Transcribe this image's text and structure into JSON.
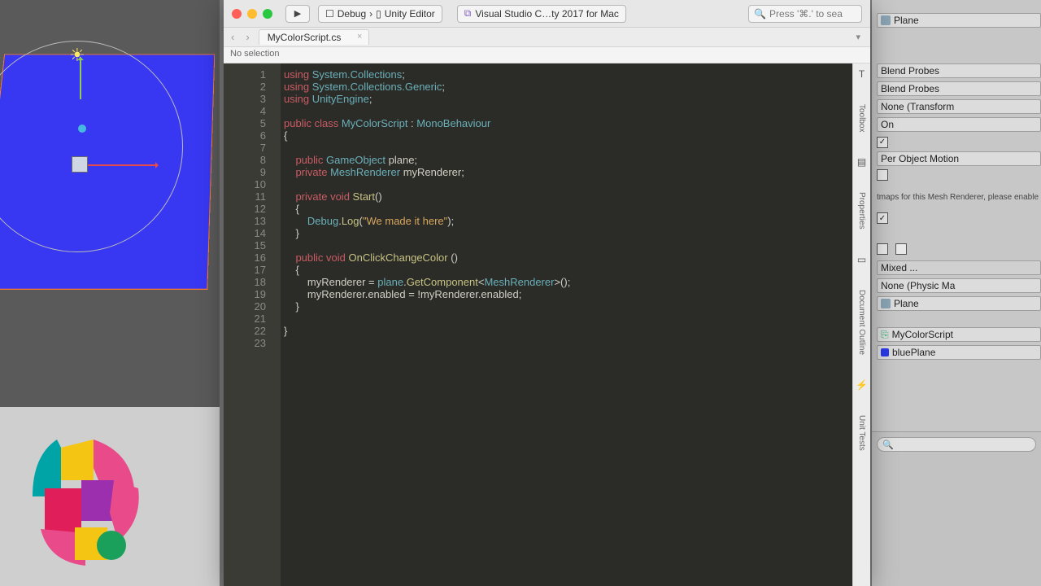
{
  "unity": {
    "inspector": {
      "planeField": "Plane",
      "blendProbes1": "Blend Probes",
      "blendProbes2": "Blend Probes",
      "anchor": "None (Transform",
      "castShadows": "On",
      "motionVectors": "Per Object Motion",
      "lightmapNote": "tmaps for this Mesh Renderer, please enable",
      "tag": "Mixed ...",
      "physicMat": "None (Physic Ma",
      "meshRef": "Plane",
      "scriptRef": "MyColorScript",
      "matRef": "bluePlane"
    }
  },
  "vs": {
    "toolbar": {
      "config": "Debug",
      "target": "Unity Editor",
      "appName": "Visual Studio C…ty 2017 for Mac",
      "searchPlaceholder": "Press '⌘.' to sea"
    },
    "tab": "MyColorScript.cs",
    "breadcrumb": "No selection",
    "sidepanels": [
      "Toolbox",
      "Properties",
      "Document Outline",
      "Unit Tests"
    ],
    "code": {
      "lines": [
        "1",
        "2",
        "3",
        "4",
        "5",
        "6",
        "7",
        "8",
        "9",
        "10",
        "11",
        "12",
        "13",
        "14",
        "15",
        "16",
        "17",
        "18",
        "19",
        "20",
        "21",
        "22",
        "23"
      ],
      "l1_a": "using ",
      "l1_b": "System.Collections",
      "l1_c": ";",
      "l2_a": "using ",
      "l2_b": "System.Collections.Generic",
      "l2_c": ";",
      "l3_a": "using ",
      "l3_b": "UnityEngine",
      "l3_c": ";",
      "l5_a": "public class ",
      "l5_b": "MyColorScript",
      "l5_c": " : ",
      "l5_d": "MonoBehaviour",
      "l6": "{",
      "l8_a": "    public ",
      "l8_b": "GameObject",
      "l8_c": " plane;",
      "l9_a": "    private ",
      "l9_b": "MeshRenderer",
      "l9_c": " myRenderer;",
      "l11_a": "    private void ",
      "l11_b": "Start",
      "l11_c": "()",
      "l12": "    {",
      "l13_a": "        Debug",
      ".": "",
      "l13_b": ".",
      "l13_c": "Log",
      "l13_d": "(",
      "l13_e": "\"We made it here\"",
      "l13_f": ");",
      "l14": "    }",
      "l16_a": "    public void ",
      "l16_b": "OnClickChangeColor",
      "l16_c": " ()",
      "l17": "    {",
      "l18_a": "        myRenderer = ",
      "l18_b": "plane",
      "l18_c": ".",
      "l18_d": "GetComponent",
      "l18_e": "<",
      "l18_f": "MeshRenderer",
      "l18_g": ">();",
      "l19": "        myRenderer.enabled = !myRenderer.enabled;",
      "l20": "    }",
      "l22": "}"
    }
  }
}
